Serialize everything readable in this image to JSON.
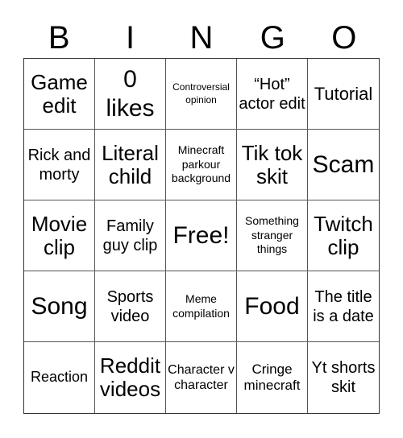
{
  "card": {
    "header": [
      "B",
      "I",
      "N",
      "G",
      "O"
    ],
    "cells": [
      [
        "Game edit",
        "0 likes",
        "Controversial opinion",
        "“Hot” actor edit",
        "Tutorial"
      ],
      [
        "Rick and morty",
        "Literal child",
        "Minecraft parkour background",
        "Tik tok skit",
        "Scam"
      ],
      [
        "Movie clip",
        "Family guy clip",
        "Free!",
        "Something stranger things",
        "Twitch clip"
      ],
      [
        "Song",
        "Sports video",
        "Meme compilation",
        "Food",
        "The title is a date"
      ],
      [
        "Reaction",
        "Reddit videos",
        "Character v character",
        "Cringe minecraft",
        "Yt shorts skit"
      ]
    ]
  }
}
